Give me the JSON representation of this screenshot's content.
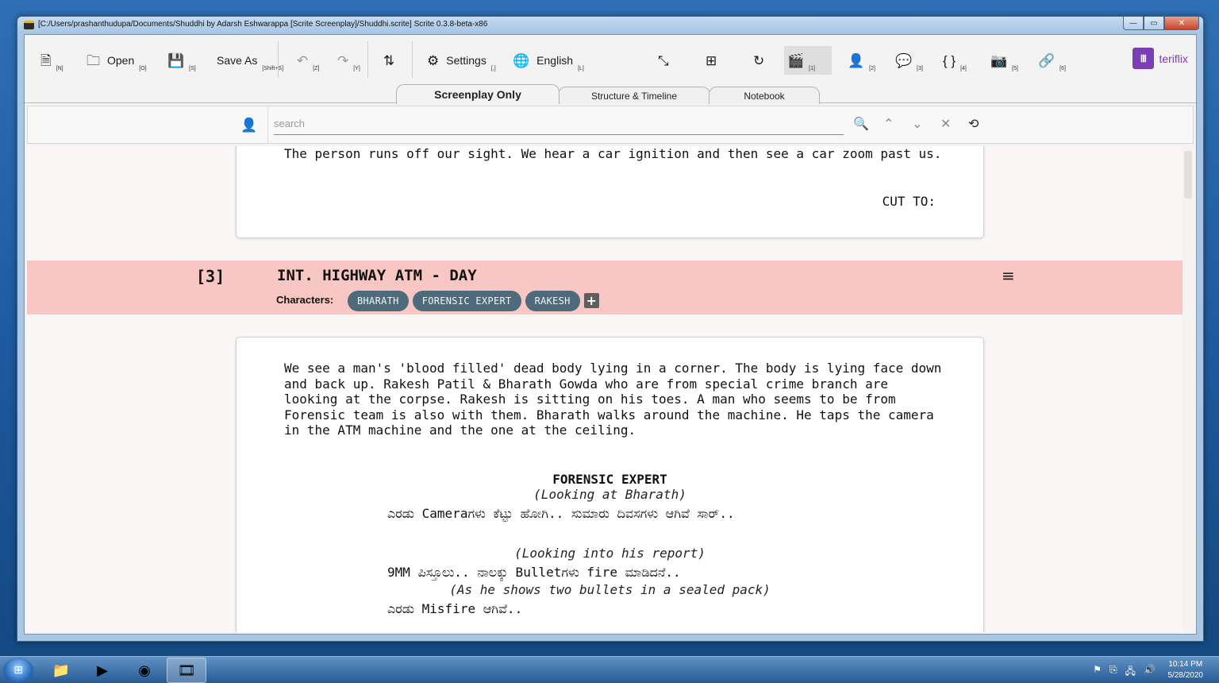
{
  "window": {
    "title": "[C:/Users/prashanthudupa/Documents/Shuddhi by Adarsh Eshwarappa [Scrite Screenplay]/Shuddhi.scrite] Scrite 0.3.8-beta-x86",
    "min": "—",
    "max": "▭",
    "close": "✕"
  },
  "toolbar": {
    "new": {
      "icon": "🗎",
      "shortcut": "[N]"
    },
    "open": {
      "icon": "🗀",
      "label": "Open",
      "shortcut": "[O]"
    },
    "save": {
      "icon": "💾",
      "shortcut": "[S]"
    },
    "save_as": {
      "label": "Save As",
      "shortcut": "[Shift+S]"
    },
    "undo": {
      "icon": "↶",
      "shortcut": "[Z]"
    },
    "redo": {
      "icon": "↷",
      "shortcut": "[Y]"
    },
    "sort": {
      "icon": "⇅"
    },
    "settings": {
      "icon": "⚙",
      "label": "Settings",
      "shortcut": "[,]"
    },
    "language": {
      "icon": "🌐",
      "label": "English",
      "shortcut": "[L]"
    },
    "collapse": {
      "icon": "⤡"
    },
    "add": {
      "icon": "⊞"
    },
    "reload": {
      "icon": "↻"
    },
    "scene": {
      "icon": "🎬",
      "shortcut": "[1]"
    },
    "character": {
      "icon": "👤",
      "shortcut": "[2]"
    },
    "comments": {
      "icon": "💬",
      "shortcut": "[3]"
    },
    "braces": {
      "icon": "{ }",
      "shortcut": "[4]"
    },
    "camera": {
      "icon": "📷",
      "shortcut": "[5]"
    },
    "link": {
      "icon": "🔗",
      "shortcut": "[6]"
    },
    "brand": {
      "logo": "Ⅲ",
      "name": "teriflix"
    }
  },
  "tabs": [
    {
      "label": "Screenplay Only"
    },
    {
      "label": "Structure & Timeline"
    },
    {
      "label": "Notebook"
    }
  ],
  "search": {
    "placeholder": "search",
    "icons": {
      "user": "👤",
      "find": "🔍",
      "prev": "⌃",
      "next": "⌄",
      "clear": "✕",
      "replace": "⟲"
    }
  },
  "scene_prev": {
    "action": "The person runs off our sight. We hear a car ignition and then see a car zoom past us.",
    "transition": "CUT TO:"
  },
  "scene": {
    "number": "[3]",
    "heading": "INT. HIGHWAY ATM - DAY",
    "menu_icon": "≡",
    "characters_label": "Characters:",
    "characters": [
      "BHARATH",
      "FORENSIC EXPERT",
      "RAKESH"
    ],
    "add_icon": "+",
    "action": "We see a man's 'blood filled' dead body lying in a corner. The body is lying face down and back up. Rakesh Patil & Bharath Gowda who are from special crime branch are looking at the corpse. Rakesh is sitting on his toes. A man who seems to be from Forensic team is also with them. Bharath walks around the machine. He taps the camera in the ATM machine and the one at the ceiling.",
    "character": "FORENSIC EXPERT",
    "parenthetical1": "(Looking at Bharath)",
    "dialogue1": "ಎರಡು Cameraಗಳು ಕೆಟ್ಟು ಹೋಗಿ.. ಸುಮಾರು ದಿವಸಗಳು ಆಗಿವೆ ಸಾರ್..",
    "parenthetical2": "(Looking into his report)",
    "dialogue2": "9MM ಪಿಸ್ತೂಲು.. ನಾಲಕ್ಕು Bulletಗಳು fire ಮಾಡಿದನೆ..",
    "parenthetical3": "(As he shows two bullets in a sealed pack)",
    "dialogue3": "ಎರಡು Misfire ಆಗಿವೆ.."
  },
  "taskbar": {
    "start": "⊞",
    "apps": [
      "📁",
      "▶",
      "◉",
      "🎞"
    ],
    "tray": [
      "⚑",
      "⎘",
      "🖧",
      "🔊"
    ],
    "time": "10:14 PM",
    "date": "5/28/2020"
  }
}
